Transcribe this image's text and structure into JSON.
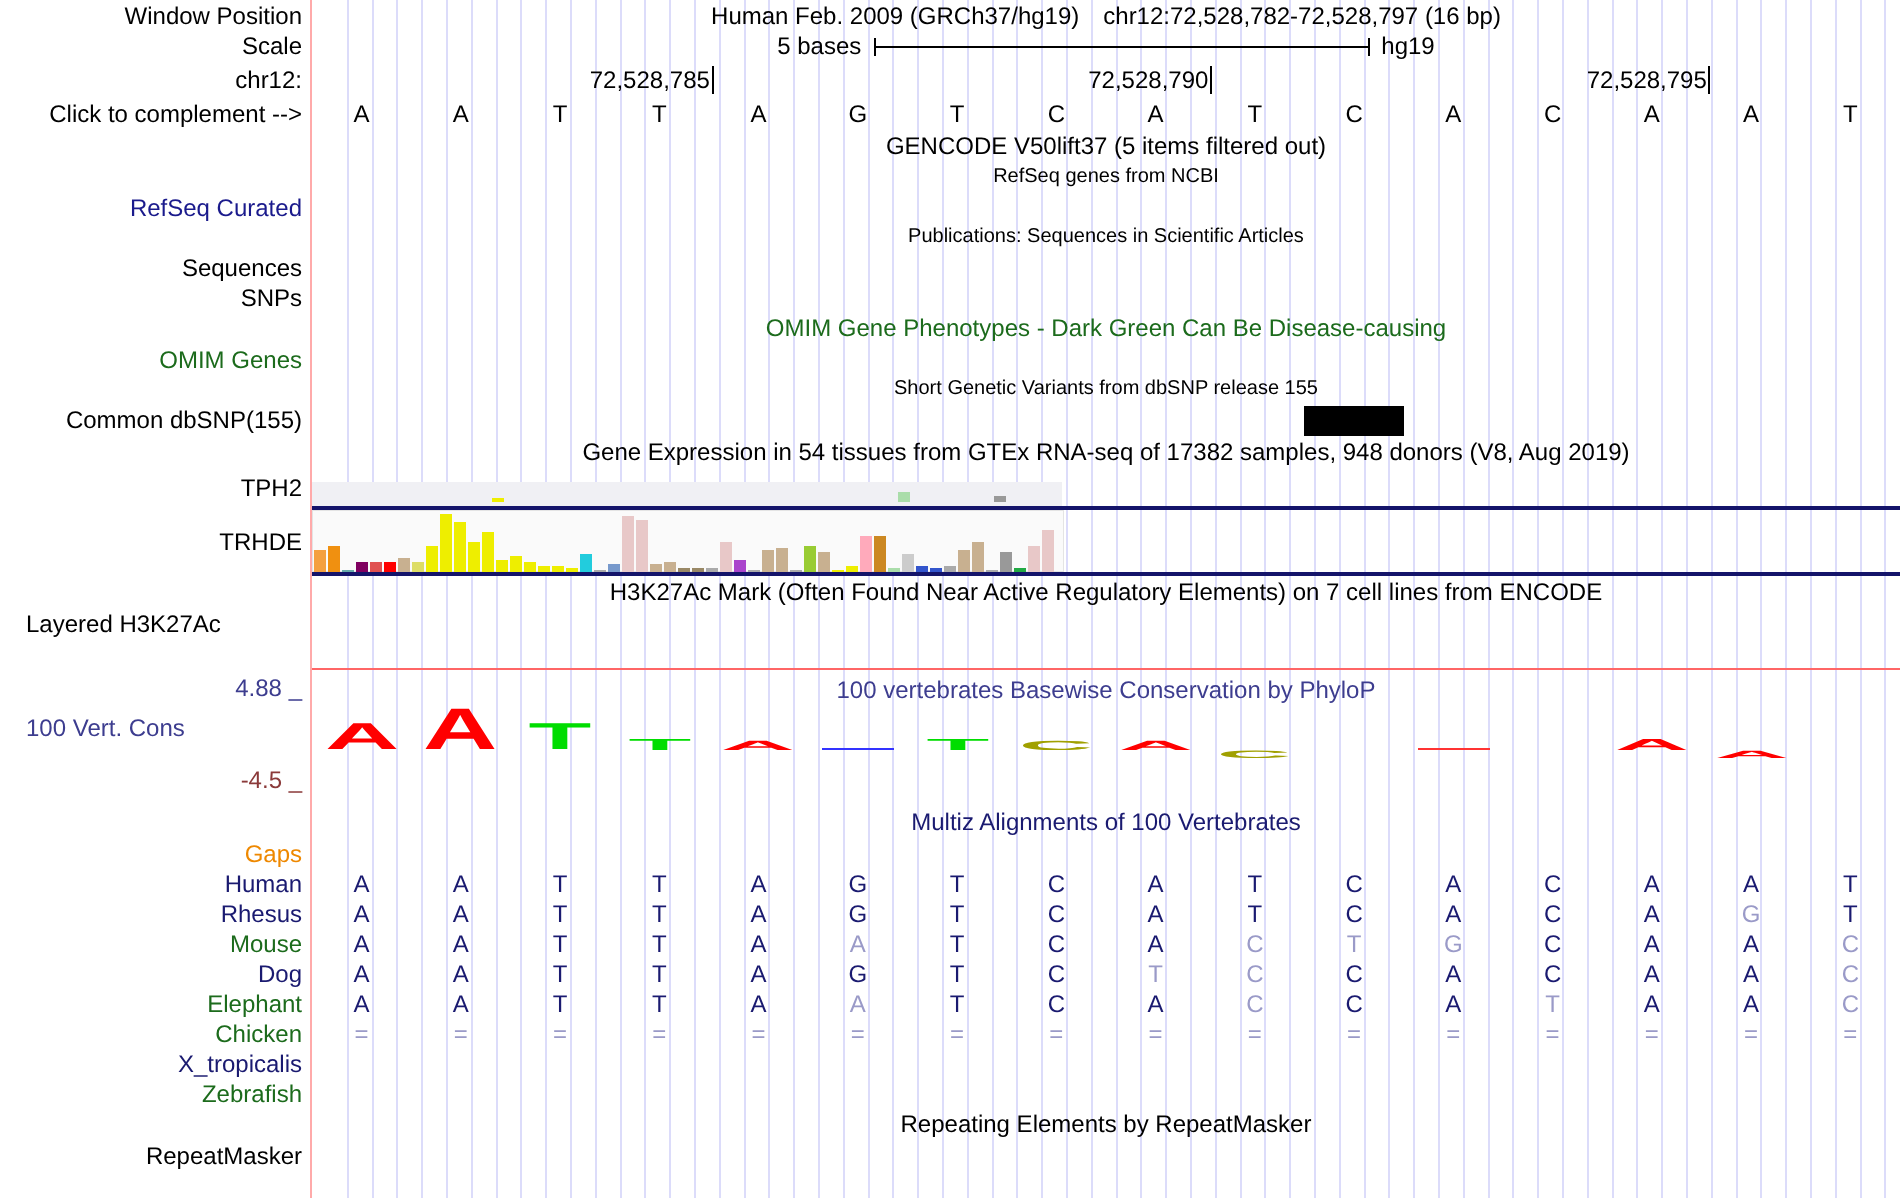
{
  "header": {
    "label": "Window Position",
    "title": "Human Feb. 2009 (GRCh37/hg19)",
    "position": "chr12:72,528,782-72,528,797 (16 bp)"
  },
  "scale": {
    "label": "Scale",
    "text": "5 bases",
    "assembly": "hg19"
  },
  "ruler": {
    "label": "chr12:",
    "ticks": [
      "72,528,785",
      "72,528,790",
      "72,528,795"
    ]
  },
  "sequence": {
    "label": "Click to complement -->",
    "bases": [
      "A",
      "A",
      "T",
      "T",
      "A",
      "G",
      "T",
      "C",
      "A",
      "T",
      "C",
      "A",
      "C",
      "A",
      "A",
      "T"
    ]
  },
  "tracks": [
    {
      "kind": "title",
      "title": "GENCODE V50lift37 (5 items filtered out)"
    },
    {
      "kind": "subtitle",
      "title": "RefSeq genes from NCBI"
    },
    {
      "kind": "track",
      "label": "RefSeq Curated",
      "color": "#1a1a8c"
    },
    {
      "kind": "subtitle",
      "title": "Publications: Sequences in Scientific Articles"
    },
    {
      "kind": "track",
      "label": "Sequences"
    },
    {
      "kind": "track",
      "label": "SNPs"
    },
    {
      "kind": "title",
      "title": "OMIM Gene Phenotypes - Dark Green Can Be Disease-causing",
      "color": "#1c6b1c"
    },
    {
      "kind": "track",
      "label": "OMIM Genes",
      "color": "#1c6b1c"
    },
    {
      "kind": "subtitle",
      "title": "Short Genetic Variants from dbSNP release 155"
    },
    {
      "kind": "variants",
      "label": "Common dbSNP(155)"
    },
    {
      "kind": "title",
      "title": "Gene Expression in 54 tissues from GTEx RNA-seq of 17382 samples, 948 donors (V8, Aug 2019)"
    },
    {
      "kind": "expression",
      "genes": [
        "TPH2",
        "TRHDE"
      ]
    },
    {
      "kind": "title",
      "title": "H3K27Ac Mark (Often Found Near Active Regulatory Elements) on 7 cell lines from ENCODE"
    },
    {
      "kind": "layered",
      "label": "Layered H3K27Ac"
    },
    {
      "kind": "conservation",
      "label": "100 Vert. Cons",
      "max": "4.88 _",
      "min": "-4.5 _",
      "title": "100 vertebrates Basewise Conservation by PhyloP",
      "logo": [
        {
          "kind": "medium",
          "letter": "A",
          "color": "#ff0000"
        },
        {
          "kind": "tall",
          "letter": "A",
          "color": "#ff0000"
        },
        {
          "kind": "medium",
          "letter": "T",
          "color": "#00dd00"
        },
        {
          "kind": "short",
          "letter": "T",
          "color": "#00dd00"
        },
        {
          "kind": "flat",
          "letter": "A",
          "color": "#ff0000"
        },
        {
          "kind": "line",
          "color": "#3333ff"
        },
        {
          "kind": "short",
          "letter": "T",
          "color": "#00dd00"
        },
        {
          "kind": "flat",
          "letter": "C",
          "color": "#a0a000"
        },
        {
          "kind": "flat",
          "letter": "A",
          "color": "#ff0000"
        },
        {
          "kind": "under",
          "letter": "C",
          "color": "#a0a000"
        },
        {
          "kind": "blank"
        },
        {
          "kind": "line",
          "color": "#ff3333"
        },
        {
          "kind": "blank"
        },
        {
          "kind": "short",
          "letter": "A",
          "color": "#ff0000"
        },
        {
          "kind": "under",
          "letter": "A",
          "color": "#ff0000"
        },
        {
          "kind": "blank"
        }
      ]
    },
    {
      "kind": "title",
      "title": "Multiz Alignments of 100 Vertebrates",
      "color": "#1a1a70"
    },
    {
      "kind": "species",
      "label": "Gaps",
      "color": "#ee8800"
    },
    {
      "kind": "species",
      "label": "Human",
      "color": "#1a1a70",
      "bases": [
        {
          "base": "A",
          "differs": false
        },
        {
          "base": "A",
          "differs": false
        },
        {
          "base": "T",
          "differs": false
        },
        {
          "base": "T",
          "differs": false
        },
        {
          "base": "A",
          "differs": false
        },
        {
          "base": "G",
          "differs": false
        },
        {
          "base": "T",
          "differs": false
        },
        {
          "base": "C",
          "differs": false
        },
        {
          "base": "A",
          "differs": false
        },
        {
          "base": "T",
          "differs": false
        },
        {
          "base": "C",
          "differs": false
        },
        {
          "base": "A",
          "differs": false
        },
        {
          "base": "C",
          "differs": false
        },
        {
          "base": "A",
          "differs": false
        },
        {
          "base": "A",
          "differs": false
        },
        {
          "base": "T",
          "differs": false
        }
      ]
    },
    {
      "kind": "species",
      "label": "Rhesus",
      "color": "#1a1a70",
      "bases": [
        {
          "base": "A",
          "differs": false
        },
        {
          "base": "A",
          "differs": false
        },
        {
          "base": "T",
          "differs": false
        },
        {
          "base": "T",
          "differs": false
        },
        {
          "base": "A",
          "differs": false
        },
        {
          "base": "G",
          "differs": false
        },
        {
          "base": "T",
          "differs": false
        },
        {
          "base": "C",
          "differs": false
        },
        {
          "base": "A",
          "differs": false
        },
        {
          "base": "T",
          "differs": false
        },
        {
          "base": "C",
          "differs": false
        },
        {
          "base": "A",
          "differs": false
        },
        {
          "base": "C",
          "differs": false
        },
        {
          "base": "A",
          "differs": false
        },
        {
          "base": "G",
          "differs": true
        },
        {
          "base": "T",
          "differs": false
        }
      ]
    },
    {
      "kind": "species",
      "label": "Mouse",
      "color": "#1c6b1c",
      "bases": [
        {
          "base": "A",
          "differs": false
        },
        {
          "base": "A",
          "differs": false
        },
        {
          "base": "T",
          "differs": false
        },
        {
          "base": "T",
          "differs": false
        },
        {
          "base": "A",
          "differs": false
        },
        {
          "base": "A",
          "differs": true
        },
        {
          "base": "T",
          "differs": false
        },
        {
          "base": "C",
          "differs": false
        },
        {
          "base": "A",
          "differs": false
        },
        {
          "base": "C",
          "differs": true
        },
        {
          "base": "T",
          "differs": true
        },
        {
          "base": "G",
          "differs": true
        },
        {
          "base": "C",
          "differs": false
        },
        {
          "base": "A",
          "differs": false
        },
        {
          "base": "A",
          "differs": false
        },
        {
          "base": "C",
          "differs": true
        }
      ]
    },
    {
      "kind": "species",
      "label": "Dog",
      "color": "#1a1a70",
      "bases": [
        {
          "base": "A",
          "differs": false
        },
        {
          "base": "A",
          "differs": false
        },
        {
          "base": "T",
          "differs": false
        },
        {
          "base": "T",
          "differs": false
        },
        {
          "base": "A",
          "differs": false
        },
        {
          "base": "G",
          "differs": false
        },
        {
          "base": "T",
          "differs": false
        },
        {
          "base": "C",
          "differs": false
        },
        {
          "base": "T",
          "differs": true
        },
        {
          "base": "C",
          "differs": true
        },
        {
          "base": "C",
          "differs": false
        },
        {
          "base": "A",
          "differs": false
        },
        {
          "base": "C",
          "differs": false
        },
        {
          "base": "A",
          "differs": false
        },
        {
          "base": "A",
          "differs": false
        },
        {
          "base": "C",
          "differs": true
        }
      ]
    },
    {
      "kind": "species",
      "label": "Elephant",
      "color": "#1c6b1c",
      "bases": [
        {
          "base": "A",
          "differs": false
        },
        {
          "base": "A",
          "differs": false
        },
        {
          "base": "T",
          "differs": false
        },
        {
          "base": "T",
          "differs": false
        },
        {
          "base": "A",
          "differs": false
        },
        {
          "base": "A",
          "differs": true
        },
        {
          "base": "T",
          "differs": false
        },
        {
          "base": "C",
          "differs": false
        },
        {
          "base": "A",
          "differs": false
        },
        {
          "base": "C",
          "differs": true
        },
        {
          "base": "C",
          "differs": false
        },
        {
          "base": "A",
          "differs": false
        },
        {
          "base": "T",
          "differs": true
        },
        {
          "base": "A",
          "differs": false
        },
        {
          "base": "A",
          "differs": false
        },
        {
          "base": "C",
          "differs": true
        }
      ]
    },
    {
      "kind": "species",
      "label": "Chicken",
      "color": "#1c6b1c",
      "bases": [
        {
          "base": "=",
          "differs": true
        },
        {
          "base": "=",
          "differs": true
        },
        {
          "base": "=",
          "differs": true
        },
        {
          "base": "=",
          "differs": true
        },
        {
          "base": "=",
          "differs": true
        },
        {
          "base": "=",
          "differs": true
        },
        {
          "base": "=",
          "differs": true
        },
        {
          "base": "=",
          "differs": true
        },
        {
          "base": "=",
          "differs": true
        },
        {
          "base": "=",
          "differs": true
        },
        {
          "base": "=",
          "differs": true
        },
        {
          "base": "=",
          "differs": true
        },
        {
          "base": "=",
          "differs": true
        },
        {
          "base": "=",
          "differs": true
        },
        {
          "base": "=",
          "differs": true
        },
        {
          "base": "=",
          "differs": true
        }
      ]
    },
    {
      "kind": "species",
      "label": "X_tropicalis",
      "color": "#1a1a70"
    },
    {
      "kind": "species",
      "label": "Zebrafish",
      "color": "#1c6b1c"
    },
    {
      "kind": "title",
      "title": "Repeating Elements by RepeatMasker"
    },
    {
      "kind": "track",
      "label": "RepeatMasker"
    }
  ]
}
